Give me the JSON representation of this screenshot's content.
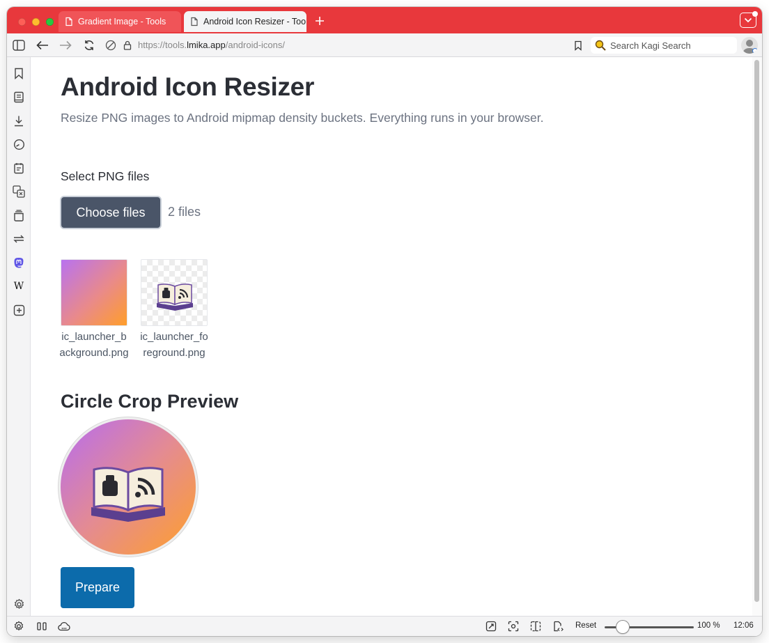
{
  "browser": {
    "tabs": [
      {
        "label": "Gradient Image - Tools",
        "active": false
      },
      {
        "label": "Android Icon Resizer - Too",
        "active": true
      }
    ],
    "new_tab_icon": "plus-icon",
    "url_prefix": "https://tools.",
    "url_domain": "lmika.app",
    "url_path": "/android-icons/",
    "search_placeholder": "Search Kagi Search",
    "accent_color": "#e8383c"
  },
  "sidebar": {
    "icons": [
      "bookmark-icon",
      "reading-list-icon",
      "download-icon",
      "history-icon",
      "notes-icon",
      "translate-icon",
      "window-panel-icon",
      "sync-icon",
      "mastodon-icon",
      "wikipedia-icon",
      "add-panel-icon",
      "settings-icon"
    ],
    "wikipedia_glyph": "W"
  },
  "page": {
    "title": "Android Icon Resizer",
    "subtitle": "Resize PNG images to Android mipmap density buckets. Everything runs in your browser.",
    "file_label": "Select PNG files",
    "choose_button": "Choose files",
    "files_count": "2 files",
    "files": [
      {
        "name": "ic_launcher_background.png",
        "kind": "gradient"
      },
      {
        "name": "ic_launcher_foreground.png",
        "kind": "transparent-book"
      }
    ],
    "preview_heading": "Circle Crop Preview",
    "prepare_button": "Prepare",
    "gradient_colors": [
      "#b872f0",
      "#ff9e2a"
    ],
    "button_color": "#4a5568",
    "prepare_color": "#0c6bab"
  },
  "statusbar": {
    "reset_label": "Reset",
    "zoom": "100 %",
    "zoom_fraction": 0.2,
    "time": "12:06"
  }
}
